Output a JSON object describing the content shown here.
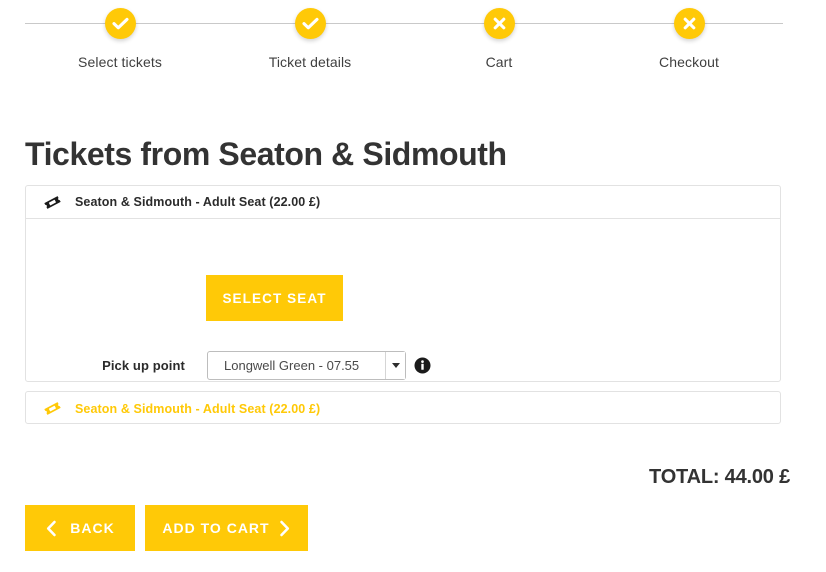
{
  "stepper": {
    "steps": [
      {
        "label": "Select tickets",
        "state": "complete",
        "icon": "check-icon"
      },
      {
        "label": "Ticket details",
        "state": "complete",
        "icon": "check-icon"
      },
      {
        "label": "Cart",
        "state": "incomplete",
        "icon": "close-icon"
      },
      {
        "label": "Checkout",
        "state": "incomplete",
        "icon": "close-icon"
      }
    ]
  },
  "page": {
    "title": "Tickets from Seaton & Sidmouth"
  },
  "ticket_panel": {
    "header": {
      "icon": "ticket-icon",
      "text": "Seaton & Sidmouth - Adult Seat (22.00 £)"
    },
    "select_seat_label": "SELECT SEAT",
    "pickup": {
      "label": "Pick up point",
      "selected_value": "Longwell Green - 07.55",
      "info_icon": "info-icon"
    }
  },
  "ticket_panel_second": {
    "header": {
      "icon": "ticket-icon",
      "text": "Seaton & Sidmouth - Adult Seat (22.00 £)"
    }
  },
  "summary": {
    "total": "TOTAL: 44.00 £"
  },
  "footer": {
    "back_label": "BACK",
    "add_to_cart_label": "ADD TO CART"
  },
  "colors": {
    "accent": "#FFC907",
    "text": "#333333",
    "border": "#e2e2e2"
  }
}
